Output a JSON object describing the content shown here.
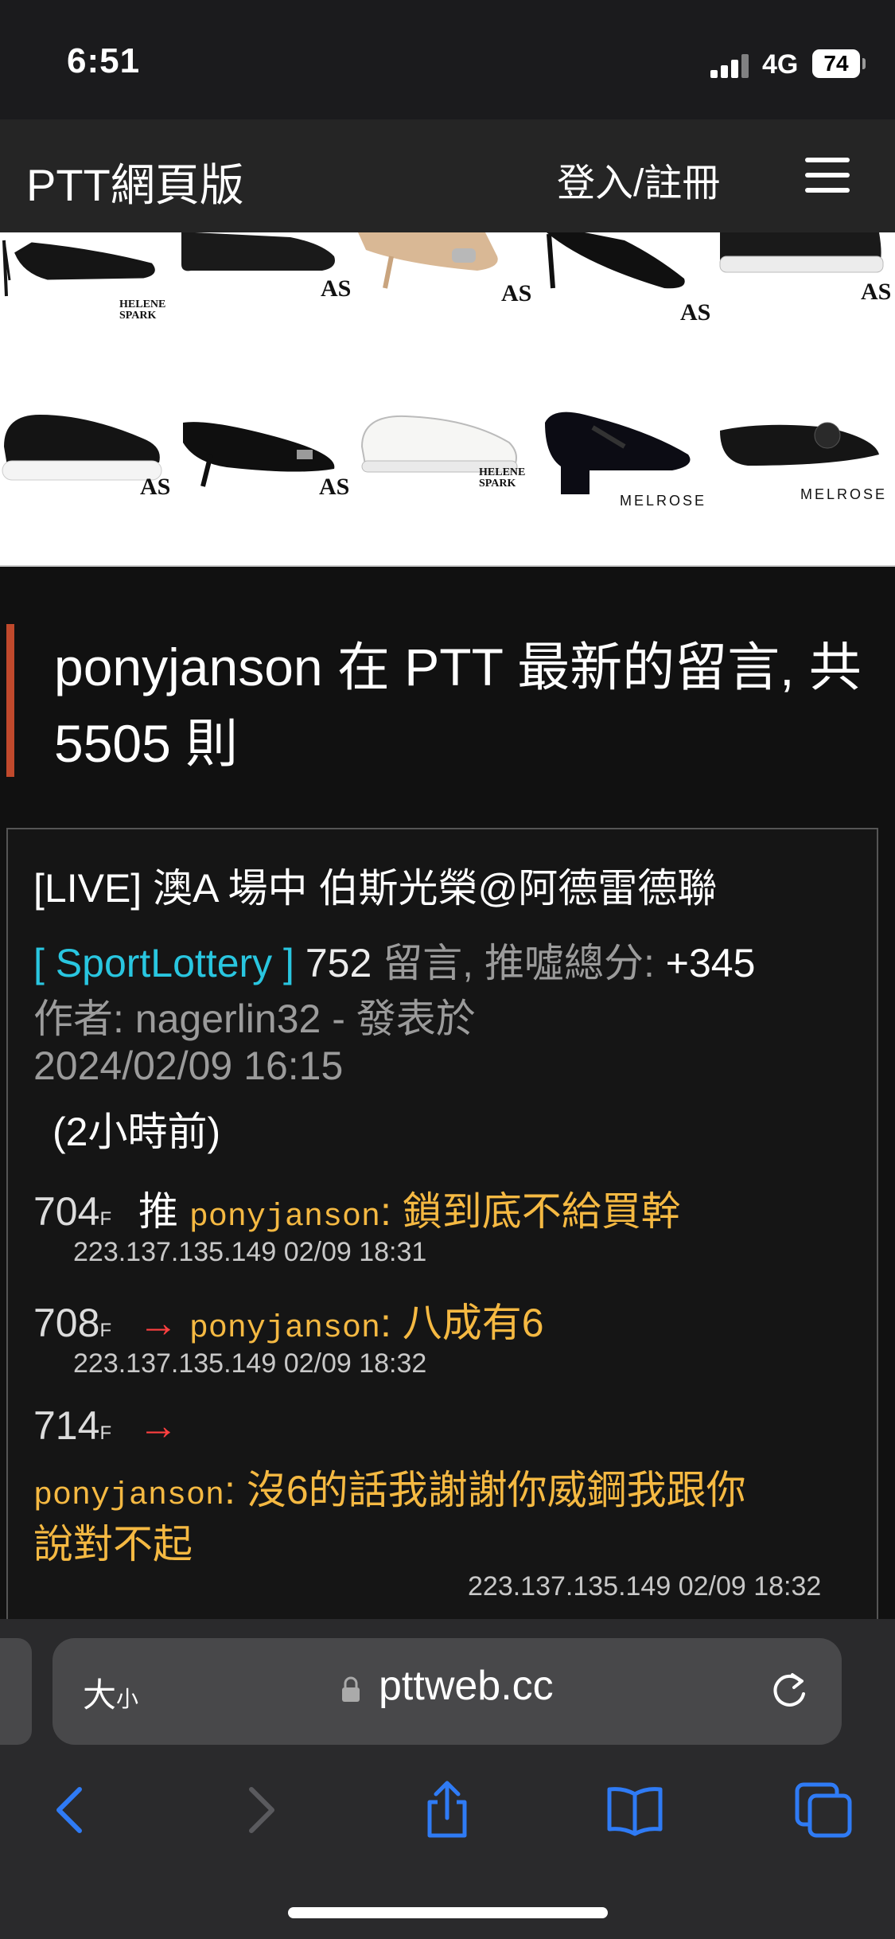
{
  "status_bar": {
    "time": "6:51",
    "network": "4G",
    "battery": "74"
  },
  "site": {
    "title": "PTT網頁版",
    "login_label": "登入/註冊"
  },
  "ad": {
    "row1": [
      "HELENE SPARK",
      "AS",
      "AS",
      "AS",
      "AS"
    ],
    "row2": [
      "AS",
      "AS",
      "HELENE SPARK",
      "MELROSE",
      "MELROSE"
    ],
    "helene_line1": "HELENE",
    "helene_line2": "SPARK"
  },
  "headline": {
    "text": "ponyjanson 在 PTT 最新的留言, 共 5505 則"
  },
  "post": {
    "title": "[LIVE] 澳A 場中 伯斯光榮@阿德雷德聯",
    "board": "[ SportLottery ]",
    "comment_count": "752",
    "comment_label": "留言, 推噓總分:",
    "score": "+345",
    "author_line": "作者: nagerlin32 - 發表於",
    "datetime": "2024/02/09 16:15",
    "relative_time": "(2小時前)"
  },
  "comments": [
    {
      "floor": "704",
      "floor_suffix": "F",
      "tag": "推",
      "user": "ponyjanson",
      "content": ": 鎖到底不給買幹",
      "meta": "223.137.135.149 02/09 18:31"
    },
    {
      "floor": "708",
      "floor_suffix": "F",
      "tag": "→",
      "user": "ponyjanson",
      "content": ": 八成有6",
      "meta": "223.137.135.149 02/09 18:32"
    },
    {
      "floor": "714",
      "floor_suffix": "F",
      "tag": "→",
      "user": "ponyjanson",
      "content": ": 沒6的話我謝謝你威鋼我跟你",
      "content2": "說對不起",
      "meta": "223.137.135.149 02/09 18:32"
    }
  ],
  "browser": {
    "text_size_label": "大",
    "text_size_small": "小",
    "url": "pttweb.cc"
  },
  "colors": {
    "accent_bar": "#c0492c",
    "board": "#29c6e0",
    "user": "#f5b942",
    "arrow": "#ff4040",
    "ios_blue": "#2f7bf5"
  },
  "icons": [
    "signal-icon",
    "battery-icon",
    "hamburger-menu-icon",
    "lock-icon",
    "reload-icon",
    "back-icon",
    "forward-icon",
    "share-icon",
    "bookmarks-icon",
    "tabs-icon"
  ]
}
